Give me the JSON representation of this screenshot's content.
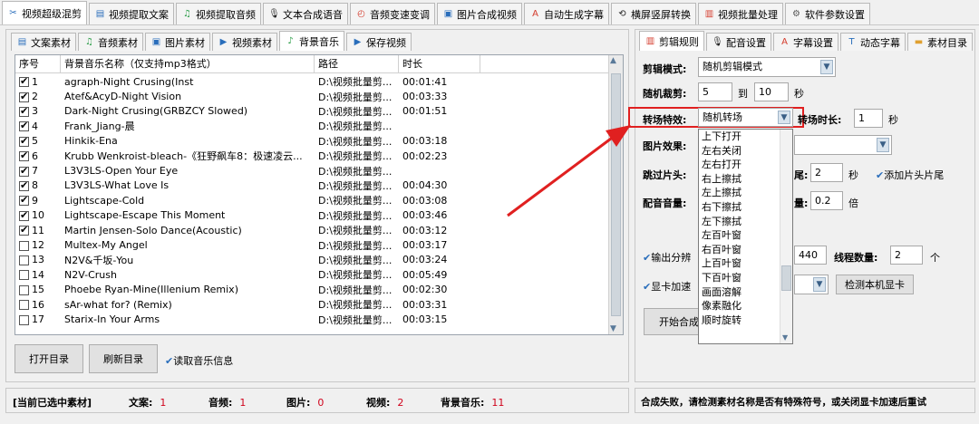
{
  "top_tabs": [
    {
      "label": "视频超级混剪",
      "icon": "scissors-icon",
      "glyph": "✂",
      "color": "#2a6ebb"
    },
    {
      "label": "视频提取文案",
      "icon": "document-icon",
      "glyph": "▤",
      "color": "#2a6ebb"
    },
    {
      "label": "视频提取音频",
      "icon": "audio-wave-icon",
      "glyph": "♫",
      "color": "#2a9d47"
    },
    {
      "label": "文本合成语音",
      "icon": "microphone-icon",
      "glyph": "🎙",
      "color": "#222"
    },
    {
      "label": "音频变速变调",
      "icon": "speedometer-icon",
      "glyph": "◴",
      "color": "#d43b2c"
    },
    {
      "label": "图片合成视频",
      "icon": "image-icon",
      "glyph": "▣",
      "color": "#2a6ebb"
    },
    {
      "label": "自动生成字幕",
      "icon": "font-icon",
      "glyph": "A",
      "color": "#d43b2c"
    },
    {
      "label": "横屏竖屏转换",
      "icon": "rotate-icon",
      "glyph": "⟲",
      "color": "#222"
    },
    {
      "label": "视频批量处理",
      "icon": "film-icon",
      "glyph": "▥",
      "color": "#d43b2c"
    },
    {
      "label": "软件参数设置",
      "icon": "gear-icon",
      "glyph": "⚙",
      "color": "#555"
    }
  ],
  "left_tabs": [
    {
      "label": "文案素材",
      "icon": "document-icon",
      "glyph": "▤",
      "color": "#2a6ebb"
    },
    {
      "label": "音频素材",
      "icon": "audio-wave-icon",
      "glyph": "♫",
      "color": "#2a9d47"
    },
    {
      "label": "图片素材",
      "icon": "image-icon",
      "glyph": "▣",
      "color": "#2a6ebb"
    },
    {
      "label": "视频素材",
      "icon": "play-icon",
      "glyph": "▶",
      "color": "#2a6ebb"
    },
    {
      "label": "背景音乐",
      "icon": "music-note-icon",
      "glyph": "♪",
      "color": "#2a9d47"
    },
    {
      "label": "保存视频",
      "icon": "save-video-icon",
      "glyph": "▶",
      "color": "#2a6ebb"
    }
  ],
  "table": {
    "headers": [
      "序号",
      "背景音乐名称（仅支持mp3格式）",
      "路径",
      "时长"
    ],
    "rows": [
      {
        "checked": true,
        "no": "1",
        "name": "agraph-Night Crusing(Inst",
        "path": "D:\\视频批量剪...",
        "dur": "00:01:41"
      },
      {
        "checked": true,
        "no": "2",
        "name": "Atef&AcyD-Night Vision",
        "path": "D:\\视频批量剪...",
        "dur": "00:03:33"
      },
      {
        "checked": true,
        "no": "3",
        "name": "Dark-Night Crusing(GRBZCY Slowed)",
        "path": "D:\\视频批量剪...",
        "dur": "00:01:51"
      },
      {
        "checked": true,
        "no": "4",
        "name": "Frank_Jiang-晨",
        "path": "D:\\视频批量剪...",
        "dur": ""
      },
      {
        "checked": true,
        "no": "5",
        "name": "Hinkik-Ena",
        "path": "D:\\视频批量剪...",
        "dur": "00:03:18"
      },
      {
        "checked": true,
        "no": "6",
        "name": "Krubb Wenkroist-bleach-《狂野飙车8：极速凌云...",
        "path": "D:\\视频批量剪...",
        "dur": "00:02:23"
      },
      {
        "checked": true,
        "no": "7",
        "name": "L3V3LS-Open Your Eye",
        "path": "D:\\视频批量剪...",
        "dur": ""
      },
      {
        "checked": true,
        "no": "8",
        "name": "L3V3LS-What Love Is",
        "path": "D:\\视频批量剪...",
        "dur": "00:04:30"
      },
      {
        "checked": true,
        "no": "9",
        "name": "Lightscape-Cold",
        "path": "D:\\视频批量剪...",
        "dur": "00:03:08"
      },
      {
        "checked": true,
        "no": "10",
        "name": "Lightscape-Escape This Moment",
        "path": "D:\\视频批量剪...",
        "dur": "00:03:46"
      },
      {
        "checked": true,
        "no": "11",
        "name": "Martin Jensen-Solo Dance(Acoustic)",
        "path": "D:\\视频批量剪...",
        "dur": "00:03:12"
      },
      {
        "checked": false,
        "no": "12",
        "name": "Multex-My Angel",
        "path": "D:\\视频批量剪...",
        "dur": "00:03:17"
      },
      {
        "checked": false,
        "no": "13",
        "name": "N2V&千坂-You",
        "path": "D:\\视频批量剪...",
        "dur": "00:03:24"
      },
      {
        "checked": false,
        "no": "14",
        "name": "N2V-Crush",
        "path": "D:\\视频批量剪...",
        "dur": "00:05:49"
      },
      {
        "checked": false,
        "no": "15",
        "name": "Phoebe Ryan-Mine(Illenium Remix)",
        "path": "D:\\视频批量剪...",
        "dur": "00:02:30"
      },
      {
        "checked": false,
        "no": "16",
        "name": "sAr-what for? (Remix)",
        "path": "D:\\视频批量剪...",
        "dur": "00:03:31"
      },
      {
        "checked": false,
        "no": "17",
        "name": "Starix-In Your Arms",
        "path": "D:\\视频批量剪...",
        "dur": "00:03:15"
      }
    ]
  },
  "buttons": {
    "open_dir": "打开目录",
    "refresh_dir": "刷新目录",
    "read_info": "读取音乐信息"
  },
  "status_left": {
    "title": "[当前已选中素材]",
    "items": [
      {
        "label": "文案:",
        "value": "1"
      },
      {
        "label": "音频:",
        "value": "1"
      },
      {
        "label": "图片:",
        "value": "0"
      },
      {
        "label": "视频:",
        "value": "2"
      },
      {
        "label": "背景音乐:",
        "value": "11"
      }
    ]
  },
  "right_tabs": [
    {
      "label": "剪辑规则",
      "icon": "film-icon",
      "glyph": "▥",
      "color": "#d43b2c"
    },
    {
      "label": "配音设置",
      "icon": "microphone-icon",
      "glyph": "🎙",
      "color": "#222"
    },
    {
      "label": "字幕设置",
      "icon": "font-icon",
      "glyph": "A",
      "color": "#d43b2c"
    },
    {
      "label": "动态字幕",
      "icon": "text-box-icon",
      "glyph": "T",
      "color": "#2a6ebb"
    },
    {
      "label": "素材目录",
      "icon": "folder-icon",
      "glyph": "▬",
      "color": "#e0a030"
    }
  ],
  "settings": {
    "mode_label": "剪辑模式:",
    "mode_value": "随机剪辑模式",
    "clip_label": "随机裁剪:",
    "clip_from": "5",
    "clip_to_word": "到",
    "clip_to": "10",
    "clip_unit": "秒",
    "trans_label": "转场特效:",
    "trans_value": "随机转场",
    "trans_dur_label": "转场时长:",
    "trans_dur_value": "1",
    "trans_dur_unit": "秒",
    "img_effect_label": "图片效果:",
    "skip_label": "跳过片头:",
    "skip_suffix": "尾:",
    "skip_value": "2",
    "skip_unit": "秒",
    "add_head_tail": "添加片头片尾",
    "dub_label": "配音音量:",
    "dub_suffix": "量:",
    "dub_value": "0.2",
    "dub_unit": "倍",
    "output_res_label": "输出分辨",
    "res_value": "440",
    "threads_label": "线程数量:",
    "threads_value": "2",
    "threads_unit": "个",
    "gpu_label": "显卡加速",
    "gpu_detect": "检测本机显卡",
    "start_label": "开始合成"
  },
  "dropdown": [
    "上下打开",
    "左右关闭",
    "左右打开",
    "右上擦拭",
    "左上擦拭",
    "右下擦拭",
    "左下擦拭",
    "左百叶窗",
    "右百叶窗",
    "上百叶窗",
    "下百叶窗",
    "画面溶解",
    "像素融化",
    "顺时旋转"
  ],
  "status_right": "合成失败，请检测素材名称是否有特殊符号，或关闭显卡加速后重试",
  "colors": {
    "highlight": "#e02020",
    "accent": "#2a6ebb",
    "value_red": "#d0021b"
  }
}
